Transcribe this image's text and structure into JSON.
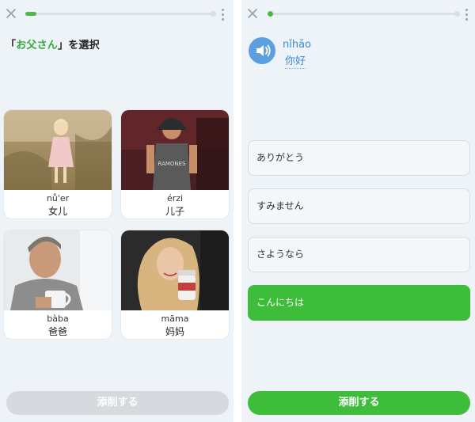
{
  "left": {
    "progress": 0.05,
    "prompt": {
      "open": "「",
      "word": "お父さん",
      "close": "」を選択"
    },
    "cards": [
      {
        "pinyin": "nǚ'er",
        "hanzi": "女儿"
      },
      {
        "pinyin": "érzi",
        "hanzi": "儿子"
      },
      {
        "pinyin": "bàba",
        "hanzi": "爸爸"
      },
      {
        "pinyin": "māma",
        "hanzi": "妈妈"
      }
    ],
    "button": "添削する"
  },
  "right": {
    "progress": 0.02,
    "audio": {
      "pinyin": "nǐhǎo",
      "hanzi": "你好"
    },
    "options": [
      {
        "label": "ありがとう",
        "selected": false
      },
      {
        "label": "すみません",
        "selected": false
      },
      {
        "label": "さようなら",
        "selected": false
      },
      {
        "label": "こんにちは",
        "selected": true
      }
    ],
    "button": "添削する"
  },
  "colors": {
    "accent_green": "#3dbd3a",
    "progress_green": "#4cb944",
    "disabled_button": "#d6d9dd",
    "audio_blue": "#5a9fe0"
  },
  "icons": {
    "close": "close-icon",
    "menu": "kebab-menu-icon",
    "audio": "speaker-icon"
  }
}
